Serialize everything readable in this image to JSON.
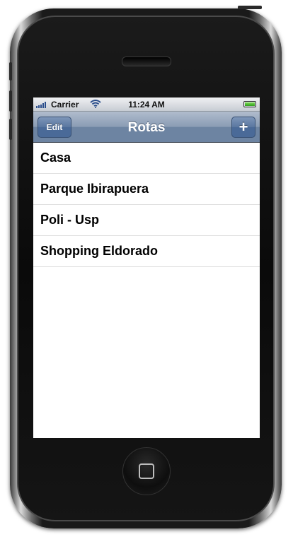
{
  "status_bar": {
    "carrier": "Carrier",
    "time": "11:24 AM",
    "battery_level": 1.0
  },
  "nav_bar": {
    "title": "Rotas",
    "edit_label": "Edit",
    "add_label": "+"
  },
  "routes": [
    {
      "name": "Casa"
    },
    {
      "name": "Parque Ibirapuera"
    },
    {
      "name": "Poli - Usp"
    },
    {
      "name": "Shopping Eldorado"
    }
  ],
  "colors": {
    "nav_bar": "#6d84a2",
    "status_bar": "#c7ccd3",
    "battery": "#2f9e1c",
    "signal": "#2b4e8c"
  }
}
